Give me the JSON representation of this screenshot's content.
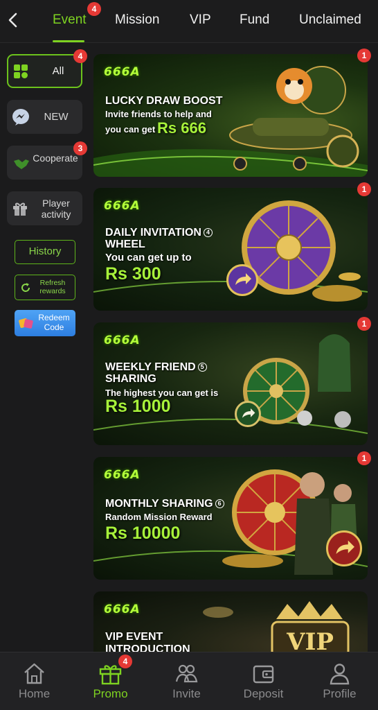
{
  "header": {
    "tabs": [
      {
        "label": "Event",
        "badge": "4",
        "active": true
      },
      {
        "label": "Mission"
      },
      {
        "label": "VIP"
      },
      {
        "label": "Fund"
      },
      {
        "label": "Unclaimed"
      }
    ]
  },
  "sidebar": {
    "items": [
      {
        "label": "All",
        "badge": "4",
        "icon": "grid-icon",
        "active": true
      },
      {
        "label": "NEW",
        "icon": "messenger-icon"
      },
      {
        "label": "Cooperate",
        "badge": "3",
        "icon": "handshake-icon"
      },
      {
        "label": "Player activity",
        "icon": "gift-box-icon"
      }
    ],
    "history_label": "History",
    "refresh_label": "Refresh rewards",
    "redeem_label": "Redeem Code"
  },
  "events": [
    {
      "brand": "666A",
      "title": "LUCKY DRAW BOOST",
      "subtitle": "Invite friends to help and",
      "subtitle2": "you can get",
      "amount": "Rs 666",
      "badge": "1"
    },
    {
      "brand": "666A",
      "title": "DAILY INVITATION",
      "title_num": "4",
      "title2": "WHEEL",
      "subtitle": "You can get up to",
      "amount": "Rs 300",
      "badge": "1"
    },
    {
      "brand": "666A",
      "title": "WEEKLY FRIEND",
      "title_num": "5",
      "title2": "SHARING",
      "subtitle": "The highest you can get is",
      "amount": "Rs 1000",
      "badge": "1"
    },
    {
      "brand": "666A",
      "title": "MONTHLY SHARING",
      "title_num": "6",
      "subtitle": "Random Mission Reward",
      "amount": "Rs 10000",
      "badge": "1"
    },
    {
      "brand": "666A",
      "title": "VIP EVENT",
      "title2": "INTRODUCTION",
      "emblem": "VIP"
    }
  ],
  "bottom_nav": [
    {
      "label": "Home",
      "icon": "home-icon"
    },
    {
      "label": "Promo",
      "icon": "gift-icon",
      "badge": "4",
      "active": true
    },
    {
      "label": "Invite",
      "icon": "invite-people-icon"
    },
    {
      "label": "Deposit",
      "icon": "wallet-icon"
    },
    {
      "label": "Profile",
      "icon": "profile-icon"
    }
  ],
  "colors": {
    "accent": "#7ed321",
    "badge": "#e53935",
    "background": "#1b1b1c"
  }
}
